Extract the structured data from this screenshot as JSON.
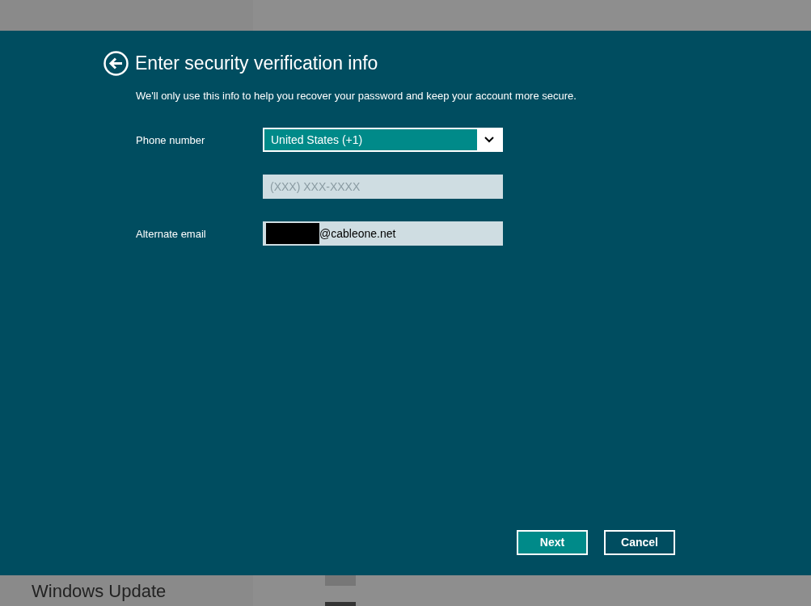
{
  "dialog": {
    "title": "Enter security verification info",
    "description": "We'll only use this info to help you recover your password and keep your account more secure.",
    "fields": [
      {
        "kind": "select",
        "label": "Phone number",
        "value": "United States (+1)"
      },
      {
        "kind": "text",
        "placeholder": "(XXX) XXX-XXXX"
      },
      {
        "kind": "email",
        "label": "Alternate email",
        "value": "@cableone.net",
        "redacted": true
      }
    ],
    "buttons": [
      {
        "label": "Next",
        "primary": true
      },
      {
        "label": "Cancel",
        "primary": false
      }
    ]
  },
  "background": {
    "sidebar_item": "Windows Update"
  }
}
